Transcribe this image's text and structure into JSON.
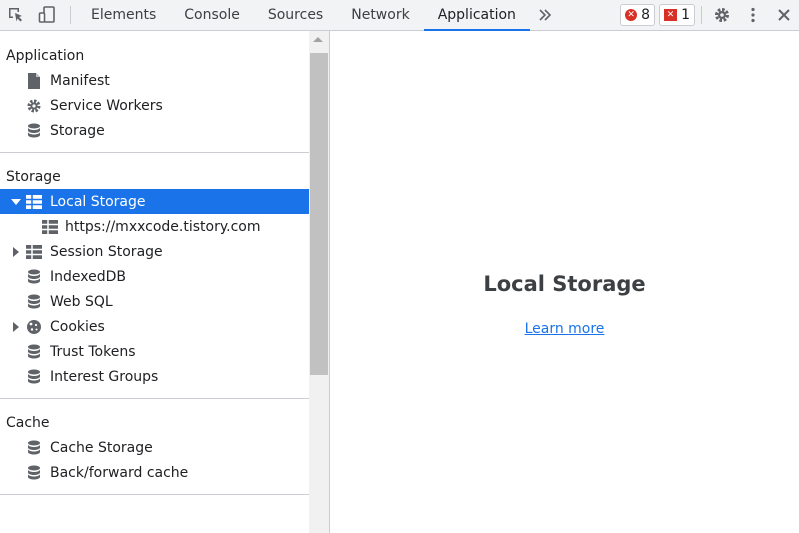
{
  "toolbar": {
    "tabs": [
      "Elements",
      "Console",
      "Sources",
      "Network",
      "Application"
    ],
    "active_tab": "Application",
    "errors_count": "8",
    "issues_count": "1",
    "accent_color": "#1a73e8",
    "error_color": "#d93025"
  },
  "sidebar": {
    "sections": [
      {
        "title": "Application",
        "items": [
          {
            "label": "Manifest",
            "icon": "file-icon"
          },
          {
            "label": "Service Workers",
            "icon": "gear-icon"
          },
          {
            "label": "Storage",
            "icon": "database-icon"
          }
        ]
      },
      {
        "title": "Storage",
        "items": [
          {
            "label": "Local Storage",
            "icon": "table-icon",
            "expanded": true,
            "selected": true
          },
          {
            "label": "https://mxxcode.tistory.com",
            "icon": "table-icon",
            "child": true
          },
          {
            "label": "Session Storage",
            "icon": "table-icon",
            "collapsed": true
          },
          {
            "label": "IndexedDB",
            "icon": "database-icon"
          },
          {
            "label": "Web SQL",
            "icon": "database-icon"
          },
          {
            "label": "Cookies",
            "icon": "cookie-icon",
            "collapsed": true
          },
          {
            "label": "Trust Tokens",
            "icon": "database-icon"
          },
          {
            "label": "Interest Groups",
            "icon": "database-icon"
          }
        ]
      },
      {
        "title": "Cache",
        "items": [
          {
            "label": "Cache Storage",
            "icon": "database-icon"
          },
          {
            "label": "Back/forward cache",
            "icon": "database-icon"
          }
        ]
      }
    ]
  },
  "main": {
    "title": "Local Storage",
    "learn_more": "Learn more"
  }
}
